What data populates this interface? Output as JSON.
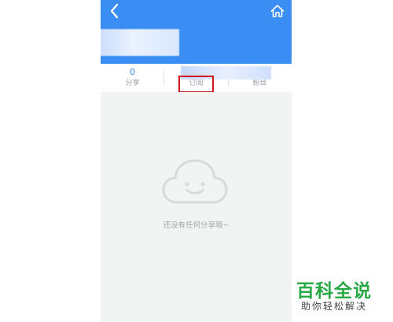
{
  "header": {
    "back_icon": "chevron-left-icon",
    "home_icon": "home-icon"
  },
  "stats": {
    "share": {
      "count": "0",
      "label": "分享"
    },
    "subscribe": {
      "label": "订阅"
    },
    "fans": {
      "label": "粉丝"
    }
  },
  "empty_state": {
    "icon": "cloud-smile-icon",
    "message": "还没有任何分享哦~"
  },
  "watermark": {
    "title": "百科全说",
    "subtitle": "助你轻松解决"
  },
  "colors": {
    "header_bg": "#3a8df2",
    "accent": "#3a8df2",
    "highlight": "#d0181c",
    "content_bg": "#f2f4f3",
    "watermark_green": "#27a844"
  }
}
